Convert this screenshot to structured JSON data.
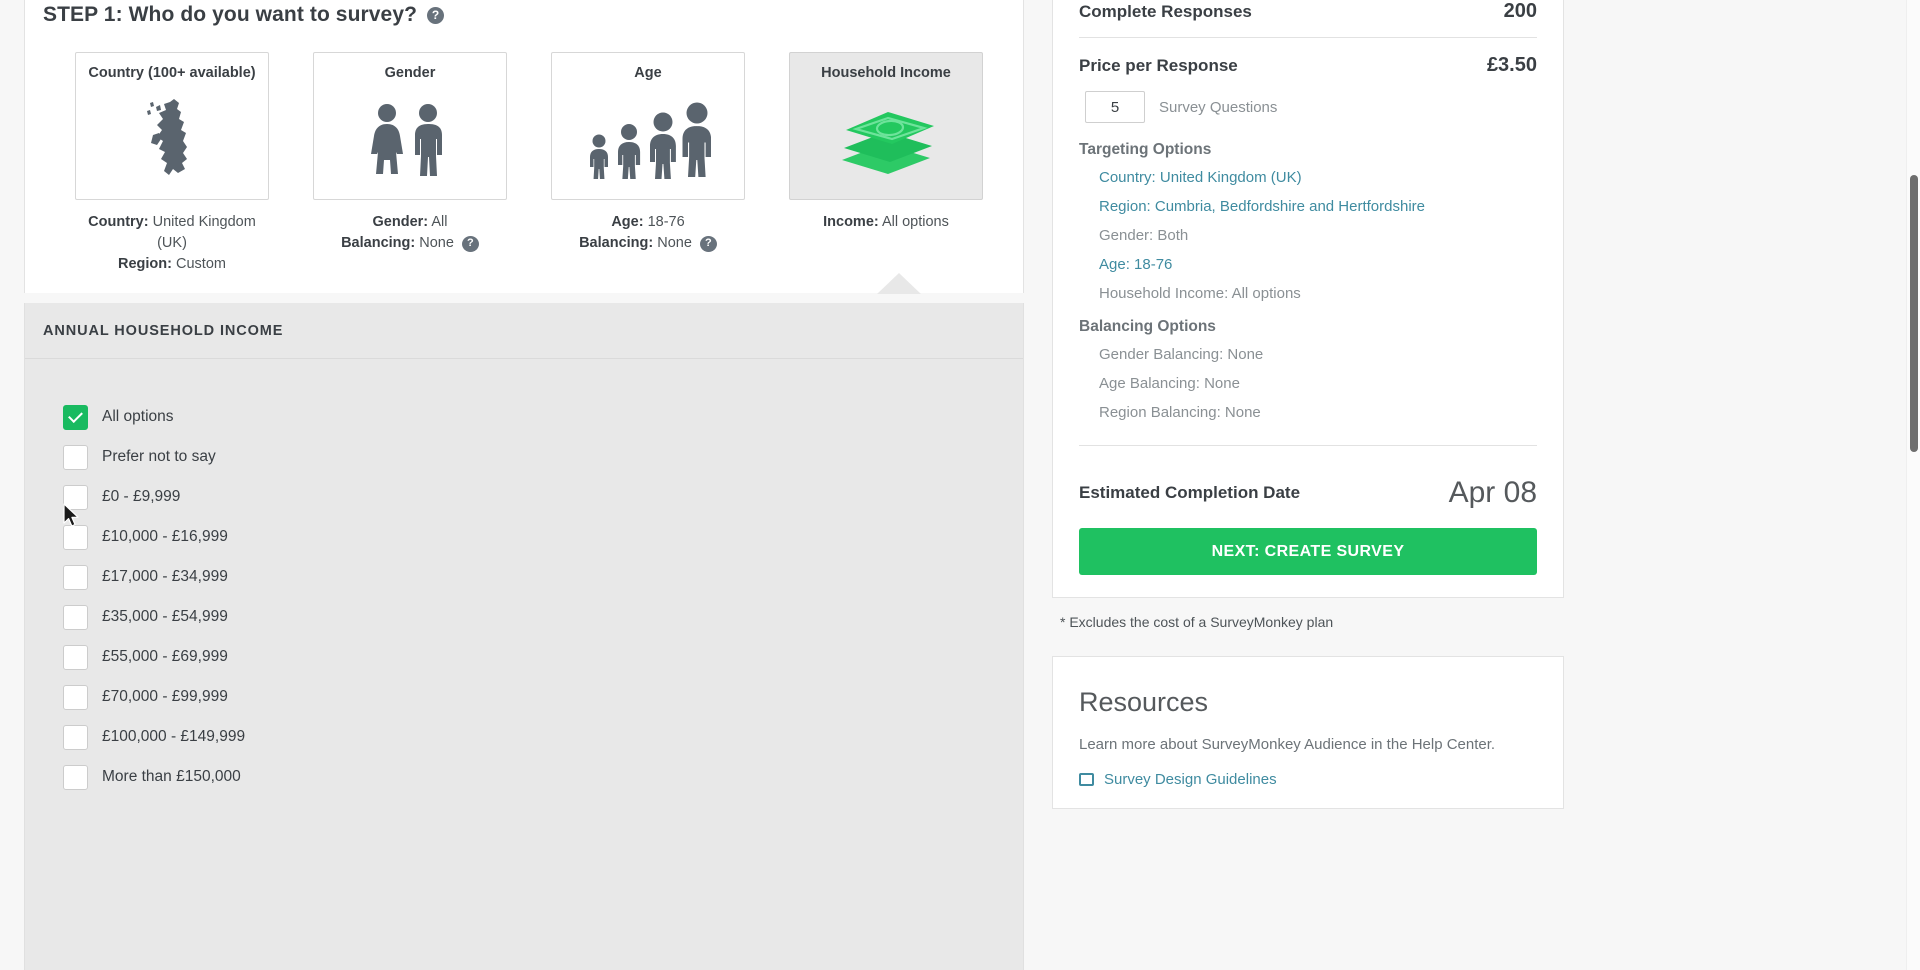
{
  "step": {
    "title": "STEP 1: Who do you want to survey?",
    "help_icon": "help-icon",
    "cards": [
      {
        "title": "Country (100+ available)",
        "icon": "uk-map-icon",
        "selected": false,
        "meta": [
          {
            "key": "Country",
            "value": "United Kingdom (UK)",
            "help": false
          },
          {
            "key": "Region",
            "value": "Custom",
            "help": false
          }
        ]
      },
      {
        "title": "Gender",
        "icon": "gender-figures-icon",
        "selected": false,
        "meta": [
          {
            "key": "Gender",
            "value": "All",
            "help": false
          },
          {
            "key": "Balancing",
            "value": "None",
            "help": true
          }
        ]
      },
      {
        "title": "Age",
        "icon": "age-figures-icon",
        "selected": false,
        "meta": [
          {
            "key": "Age",
            "value": "18-76",
            "help": false
          },
          {
            "key": "Balancing",
            "value": "None",
            "help": true
          }
        ]
      },
      {
        "title": "Household Income",
        "icon": "money-stack-icon",
        "selected": true,
        "meta": [
          {
            "key": "Income",
            "value": "All options",
            "help": false
          }
        ]
      }
    ]
  },
  "income_section": {
    "header": "ANNUAL HOUSEHOLD INCOME",
    "options": [
      {
        "label": "All options",
        "checked": true
      },
      {
        "label": "Prefer not to say",
        "checked": false
      },
      {
        "label": "£0 - £9,999",
        "checked": false
      },
      {
        "label": "£10,000 - £16,999",
        "checked": false
      },
      {
        "label": "£17,000 - £34,999",
        "checked": false
      },
      {
        "label": "£35,000 - £54,999",
        "checked": false
      },
      {
        "label": "£55,000 - £69,999",
        "checked": false
      },
      {
        "label": "£70,000 - £99,999",
        "checked": false
      },
      {
        "label": "£100,000 - £149,999",
        "checked": false
      },
      {
        "label": "More than £150,000",
        "checked": false
      }
    ]
  },
  "summary": {
    "complete_responses_label": "Complete Responses",
    "complete_responses_value": "200",
    "price_label": "Price per Response",
    "price_value": "£3.50",
    "questions_value": "5",
    "questions_label": "Survey Questions",
    "targeting_title": "Targeting Options",
    "targeting": [
      {
        "text": "Country: United Kingdom (UK)",
        "link": true
      },
      {
        "text": "Region: Cumbria, Bedfordshire and Hertfordshire",
        "link": true
      },
      {
        "text": "Gender: Both",
        "link": false
      },
      {
        "text": "Age: 18-76",
        "link": true
      },
      {
        "text": "Household Income: All options",
        "link": false
      }
    ],
    "balancing_title": "Balancing Options",
    "balancing": [
      {
        "text": "Gender Balancing: None",
        "link": false
      },
      {
        "text": "Age Balancing: None",
        "link": false
      },
      {
        "text": "Region Balancing: None",
        "link": false
      }
    ],
    "date_label": "Estimated Completion Date",
    "date_value": "Apr 08",
    "cta_label": "NEXT: CREATE SURVEY",
    "footnote": "* Excludes the cost of a SurveyMonkey plan"
  },
  "resources": {
    "title": "Resources",
    "subtitle": "Learn more about SurveyMonkey Audience in the Help Center.",
    "item": "Survey Design Guidelines"
  },
  "colors": {
    "brand_green": "#1fc161",
    "check_green": "#19ba60",
    "link_teal": "#3f8ba0",
    "figure_gray": "#5a646e",
    "panel_gray": "#e8e8e8"
  }
}
